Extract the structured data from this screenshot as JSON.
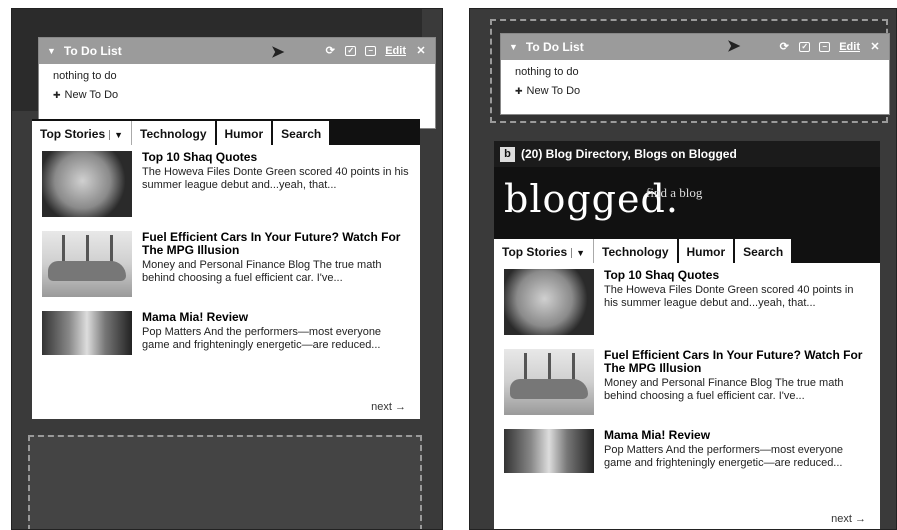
{
  "todo": {
    "title": "To Do List",
    "edit_label": "Edit",
    "empty_text": "nothing to do",
    "new_label": "New To Do"
  },
  "blog": {
    "header_title": "(20) Blog Directory, Blogs on Blogged",
    "logo": "blogged.",
    "tagline": "find a blog"
  },
  "tabs": [
    "Top Stories",
    "Technology",
    "Humor",
    "Search"
  ],
  "stories": [
    {
      "title": "Top 10 Shaq Quotes",
      "summary": "The Howeva Files Donte Green scored 40 points in his summer league debut and...yeah, that..."
    },
    {
      "title": "Fuel Efficient Cars In Your Future? Watch For The MPG Illusion",
      "summary": "Money and Personal Finance Blog The true math behind choosing a fuel efficient car. I've..."
    },
    {
      "title": "Mama Mia! Review",
      "summary": "Pop Matters And the performers—most everyone game and frighteningly energetic—are reduced..."
    }
  ],
  "next_label": "next"
}
